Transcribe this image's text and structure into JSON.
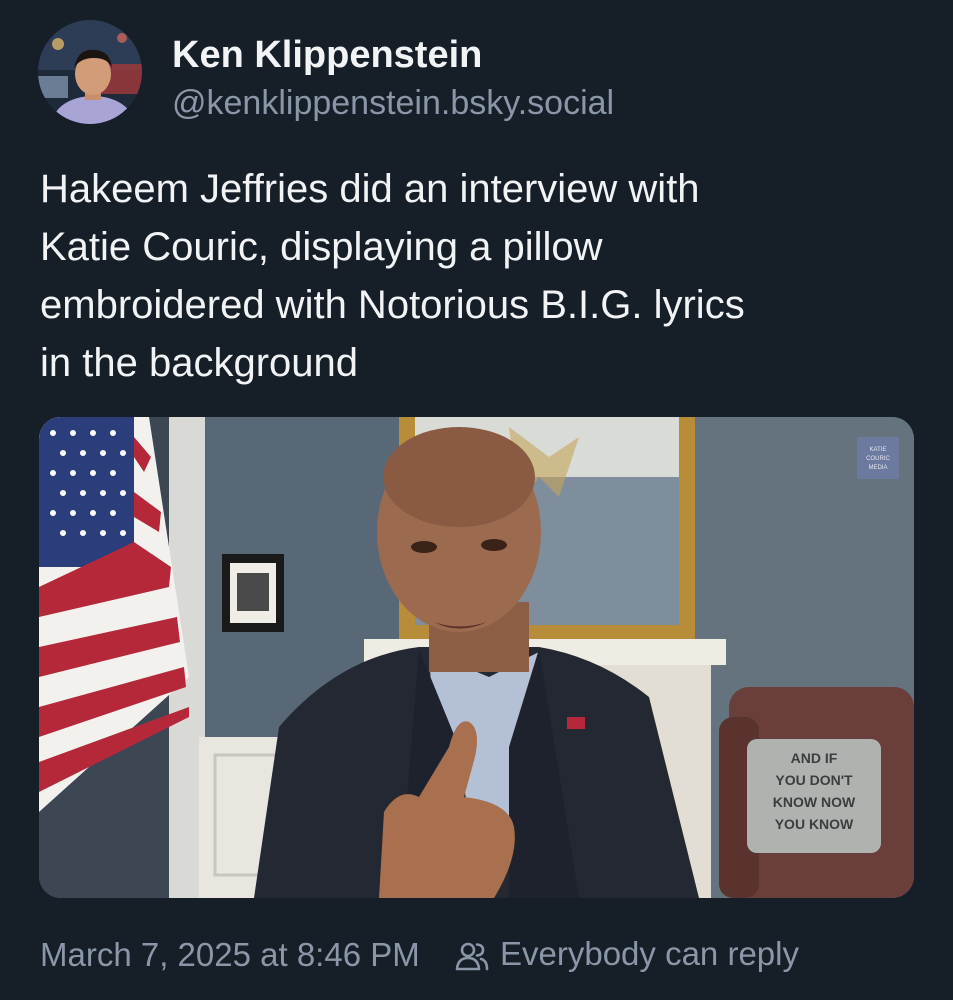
{
  "author": {
    "name": "Ken Klippenstein",
    "handle": "@kenklippenstein.bsky.social"
  },
  "post": {
    "text": "Hakeem Jeffries did an interview with\nKatie Couric, displaying a pillow\nembroidered with Notorious B.I.G. lyrics\nin the background"
  },
  "media": {
    "watermark_lines": [
      "KATIE",
      "COURIC",
      "MEDIA"
    ],
    "pillow_lines": [
      "AND IF",
      "YOU DON'T",
      "KNOW NOW",
      "YOU KNOW"
    ]
  },
  "footer": {
    "timestamp": "March 7, 2025 at 8:46 PM",
    "reply_setting": "Everybody can reply",
    "reply_icon": "people-icon"
  },
  "colors": {
    "background": "#161e27",
    "text_primary": "#f1f3f5",
    "text_secondary": "#8a97a8"
  }
}
